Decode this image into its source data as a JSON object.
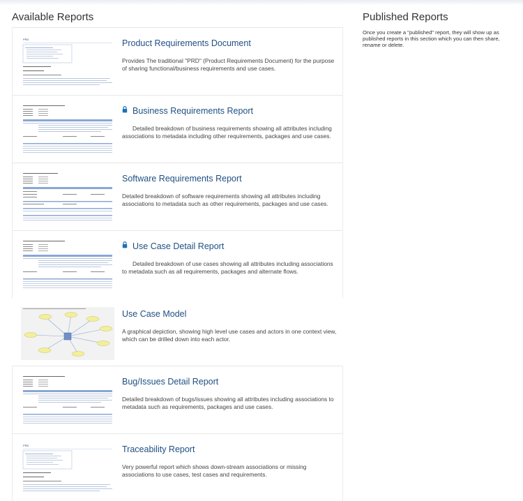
{
  "available_title": "Available Reports",
  "published": {
    "title": "Published Reports",
    "description": "Once you create a \"published\" report, they will show up as published reports in this section which you can then share, rename or delete."
  },
  "reports": [
    {
      "title": "Product Requirements Document",
      "locked": false,
      "thumbnail": "prd-document-thumbnail",
      "description": "Provides The traditional \"PRD\" (Product Requirements Document) for the purpose of sharing functional/business requirements and use cases."
    },
    {
      "title": "Business Requirements Report",
      "locked": true,
      "thumbnail": "detail-table-thumbnail",
      "description": "Detailed breakdown of business requirements showing all attributes including associations to metadata including other requirements, packages and use cases."
    },
    {
      "title": "Software Requirements Report",
      "locked": false,
      "thumbnail": "form-table-thumbnail",
      "description": "Detailed breakdown of software requirements showing all attributes including associations to metadata such as other requirements, packages and use cases."
    },
    {
      "title": "Use Case Detail Report",
      "locked": true,
      "thumbnail": "detail-table-thumbnail",
      "description": "Detailed breakdown of use cases showing all attributes including associations to metadata such as all requirements, packages and alternate flows."
    },
    {
      "title": "Use Case Model",
      "locked": false,
      "thumbnail": "diagram-thumbnail",
      "description": "A graphical depiction, showing high level use cases and actors in one context view, which can be drilled down into each actor."
    },
    {
      "title": "Bug/Issues Detail Report",
      "locked": false,
      "thumbnail": "detail-table-thumbnail",
      "description": "Detailed breakdown of bugs/issues showing all attributes including associations to metadata such as requirements, packages and use cases."
    },
    {
      "title": "Traceability Report",
      "locked": false,
      "thumbnail": "prd-document-thumbnail",
      "description": "Very powerful report which shows down-stream associations or missing associations to use cases, test cases and requirements."
    }
  ],
  "colors": {
    "title_link": "#1f4f82",
    "lock_icon": "#1f6fb5",
    "header_band": "#8aa7d4",
    "node_yellow": "#f3ef9a"
  }
}
